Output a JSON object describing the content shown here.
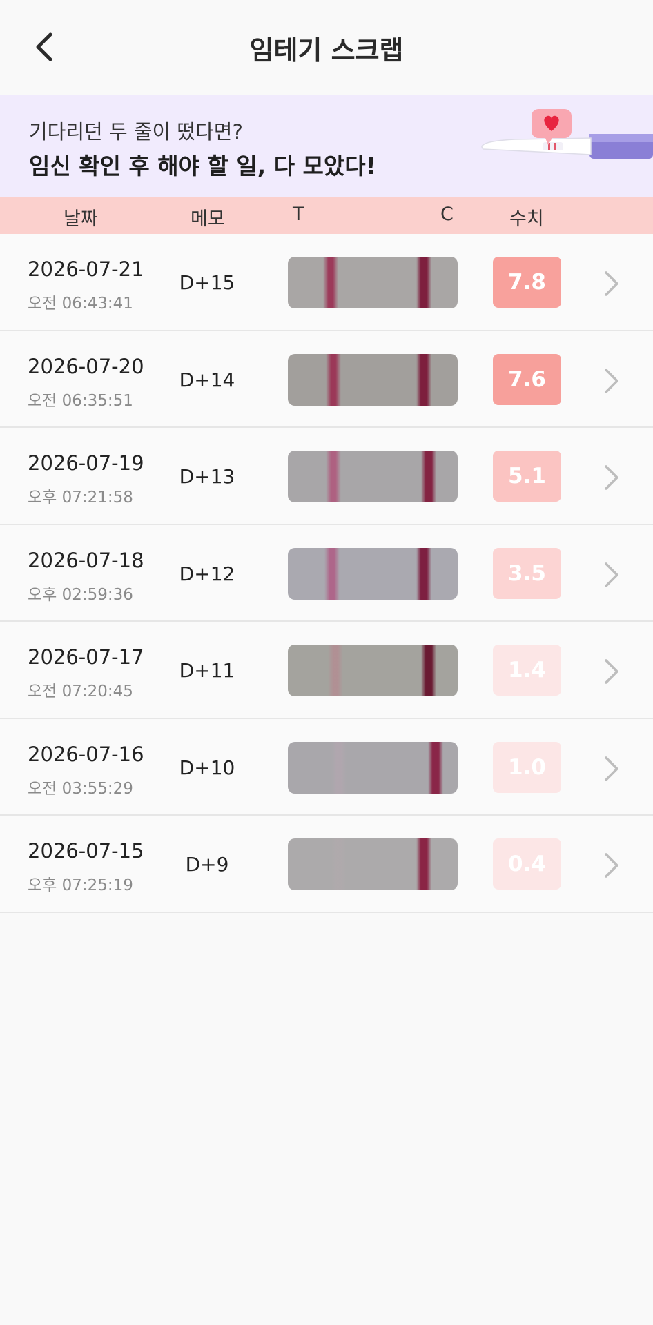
{
  "header": {
    "title": "임테기 스크랩",
    "back_icon": "chevron-left-icon"
  },
  "banner": {
    "subtitle": "기다리던 두 줄이 떴다면?",
    "headline": "임신 확인 후 해야 할 일, 다 모았다!",
    "art_icon": "pregnancy-test-heart-icon"
  },
  "columns": {
    "date": "날짜",
    "memo": "메모",
    "t": "T",
    "c": "C",
    "value": "수치"
  },
  "records": [
    {
      "date": "2026-07-21",
      "time": "오전 06:43:41",
      "memo": "D+15",
      "value": "7.8",
      "badge_color": "#f8a19c",
      "strip_bg": "#a9a6a5",
      "t_color": "#9b2e52",
      "t_opacity": 0.9,
      "t_pos": 0.25,
      "c_color": "#7e1f3e",
      "c_pos": 0.8
    },
    {
      "date": "2026-07-20",
      "time": "오전 06:35:51",
      "memo": "D+14",
      "value": "7.6",
      "badge_color": "#f7a09b",
      "strip_bg": "#a29f9c",
      "t_color": "#9a2d50",
      "t_opacity": 0.9,
      "t_pos": 0.27,
      "c_color": "#7d1f3d",
      "c_pos": 0.8
    },
    {
      "date": "2026-07-19",
      "time": "오후 07:21:58",
      "memo": "D+13",
      "value": "5.1",
      "badge_color": "#fbc4c2",
      "strip_bg": "#a8a6a8",
      "t_color": "#b04a74",
      "t_opacity": 0.75,
      "t_pos": 0.27,
      "c_color": "#842342",
      "c_pos": 0.83
    },
    {
      "date": "2026-07-18",
      "time": "오후 02:59:36",
      "memo": "D+12",
      "value": "3.5",
      "badge_color": "#fcd4d3",
      "strip_bg": "#aaa9b0",
      "t_color": "#b04a7a",
      "t_opacity": 0.7,
      "t_pos": 0.26,
      "c_color": "#7d1f41",
      "c_pos": 0.8
    },
    {
      "date": "2026-07-17",
      "time": "오전 07:20:45",
      "memo": "D+11",
      "value": "1.4",
      "badge_color": "#fce6e6",
      "strip_bg": "#a4a39e",
      "t_color": "#c07a88",
      "t_opacity": 0.45,
      "t_pos": 0.28,
      "c_color": "#6a1a32",
      "c_pos": 0.83
    },
    {
      "date": "2026-07-16",
      "time": "오전 03:55:29",
      "memo": "D+10",
      "value": "1.0",
      "badge_color": "#fce6e6",
      "strip_bg": "#a9a7ab",
      "t_color": "#b9a6b2",
      "t_opacity": 0.45,
      "t_pos": 0.3,
      "c_color": "#8a2648",
      "c_pos": 0.87
    },
    {
      "date": "2026-07-15",
      "time": "오후 07:25:19",
      "memo": "D+9",
      "value": "0.4",
      "badge_color": "#fce6e6",
      "strip_bg": "#acaaab",
      "t_color": "#b7a8ae",
      "t_opacity": 0.3,
      "t_pos": 0.3,
      "c_color": "#8a2545",
      "c_pos": 0.8
    }
  ]
}
